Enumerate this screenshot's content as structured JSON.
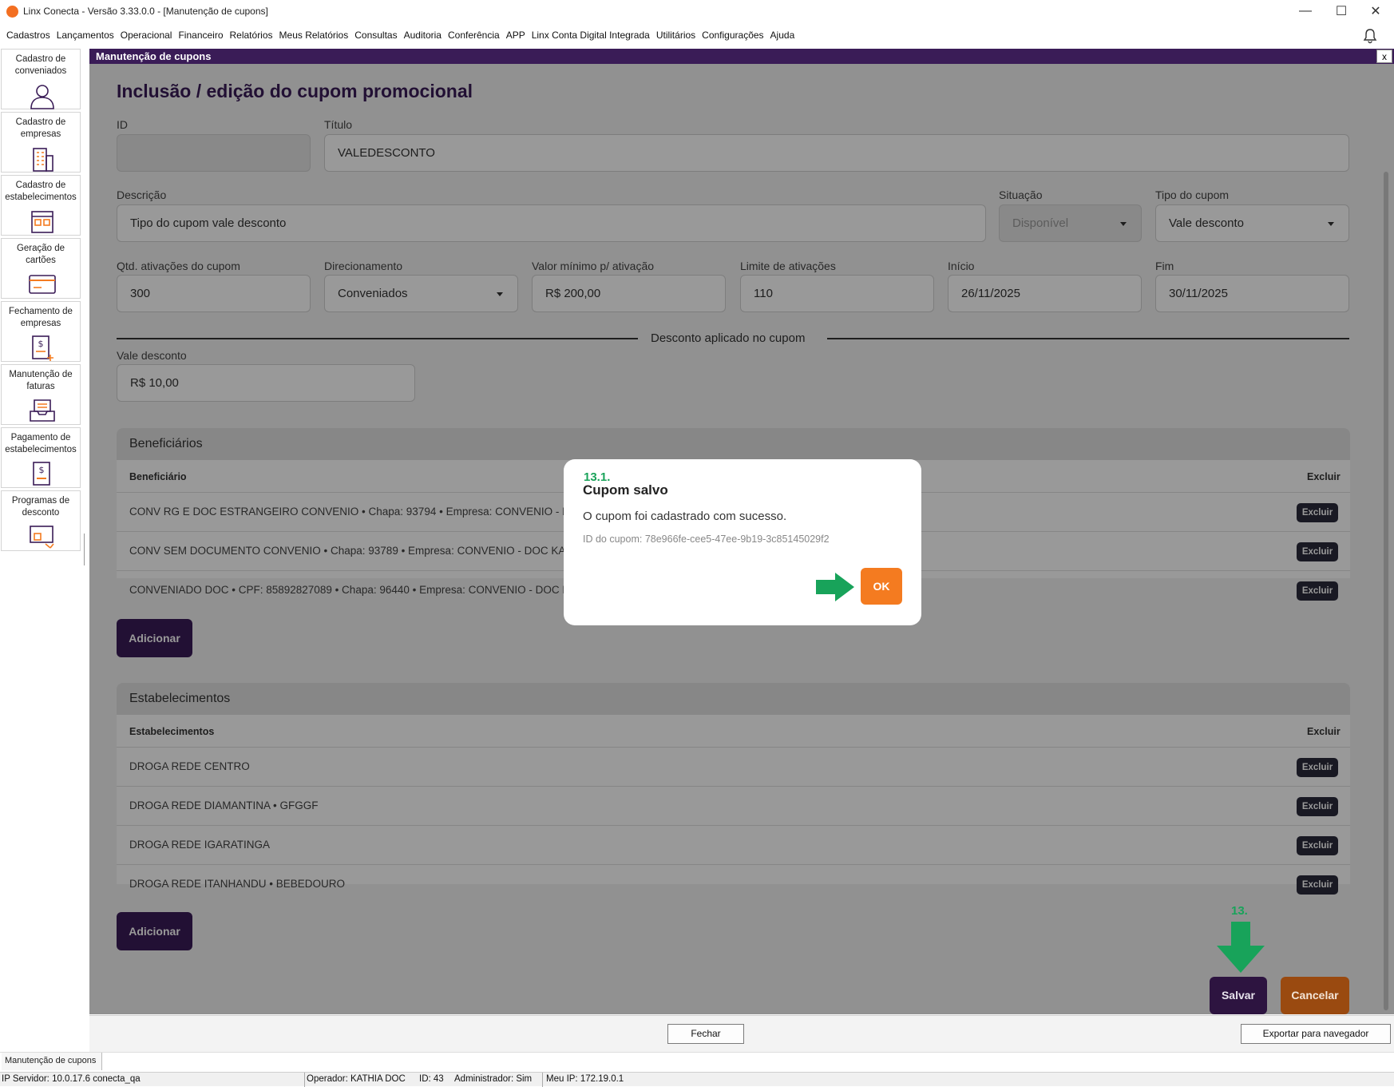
{
  "window": {
    "title": "Linx Conecta - Versão 3.33.0.0 - [Manutenção de cupons]",
    "minimize": "—",
    "maximize": "☐",
    "close": "✕"
  },
  "menu": [
    "Cadastros",
    "Lançamentos",
    "Operacional",
    "Financeiro",
    "Relatórios",
    "Meus Relatórios",
    "Consultas",
    "Auditoria",
    "Conferência",
    "APP",
    "Linx Conta Digital Integrada",
    "Utilitários",
    "Configurações",
    "Ajuda"
  ],
  "sidebar": {
    "items": [
      {
        "label": "Cadastro de conveniados",
        "icon": "user-icon"
      },
      {
        "label": "Cadastro de empresas",
        "icon": "building-icon"
      },
      {
        "label": "Cadastro de estabelecimentos",
        "icon": "store-icon"
      },
      {
        "label": "Geração de cartões",
        "icon": "card-icon"
      },
      {
        "label": "Fechamento de empresas",
        "icon": "invoice-icon"
      },
      {
        "label": "Manutenção de faturas",
        "icon": "tray-icon"
      },
      {
        "label": "Pagamento de estabelecimentos",
        "icon": "payment-icon"
      },
      {
        "label": "Programas de desconto",
        "icon": "discount-icon"
      }
    ]
  },
  "mdi": {
    "title": "Manutenção de cupons",
    "close": "x"
  },
  "form": {
    "heading": "Inclusão / edição do cupom promocional",
    "id_label": "ID",
    "id_value": "",
    "titulo_label": "Título",
    "titulo_value": "VALEDESCONTO",
    "descricao_label": "Descrição",
    "descricao_value": "Tipo do cupom vale desconto",
    "situacao_label": "Situação",
    "situacao_value": "Disponível",
    "tipo_label": "Tipo do cupom",
    "tipo_value": "Vale desconto",
    "qtd_label": "Qtd. ativações do cupom",
    "qtd_value": "300",
    "direcionamento_label": "Direcionamento",
    "direcionamento_value": "Conveniados",
    "valor_min_label": "Valor mínimo p/ ativação",
    "valor_min_value": "R$ 200,00",
    "limite_label": "Limite de ativações",
    "limite_value": "110",
    "inicio_label": "Início",
    "inicio_value": "26/11/2025",
    "fim_label": "Fim",
    "fim_value": "30/11/2025",
    "divider_label": "Desconto aplicado no cupom",
    "vale_label": "Vale desconto",
    "vale_value": "R$ 10,00"
  },
  "beneficiarios": {
    "title": "Beneficiários",
    "col_name": "Beneficiário",
    "col_delete": "Excluir",
    "rows": [
      "CONV RG E DOC ESTRANGEIRO CONVENIO • Chapa: 93794 • Empresa: CONVENIO - DO",
      "CONV SEM DOCUMENTO CONVENIO • Chapa: 93789 • Empresa: CONVENIO - DOC KAT",
      "CONVENIADO DOC • CPF: 85892827089 • Chapa: 96440 • Empresa: CONVENIO - DOC K"
    ],
    "delete_label": "Excluir",
    "add_label": "Adicionar"
  },
  "estabelecimentos": {
    "title": "Estabelecimentos",
    "col_name": "Estabelecimentos",
    "col_delete": "Excluir",
    "rows": [
      "DROGA REDE CENTRO",
      "DROGA REDE DIAMANTINA • GFGGF",
      "DROGA REDE IGARATINGA",
      "DROGA REDE ITANHANDU • BEBEDOURO"
    ],
    "delete_label": "Excluir",
    "add_label": "Adicionar"
  },
  "actions": {
    "save": "Salvar",
    "cancel": "Cancelar",
    "step": "13."
  },
  "modal": {
    "step": "13.1.",
    "title": "Cupom salvo",
    "message": "O cupom foi cadastrado com sucesso.",
    "id_text": "ID do cupom: 78e966fe-cee5-47ee-9b19-3c85145029f2",
    "ok": "OK"
  },
  "bottom": {
    "close": "Fechar",
    "export": "Exportar para navegador"
  },
  "taskbar": {
    "item": "Manutenção de cupons"
  },
  "status": {
    "server": "IP Servidor: 10.0.17.6 conecta_qa",
    "operator": "Operador: KATHIA DOC",
    "id": "ID: 43",
    "admin": "Administrador: Sim",
    "ip": "Meu IP: 172.19.0.1"
  },
  "colors": {
    "brand": "#3a1c57",
    "accent": "#f47b20",
    "guide": "#18a35a"
  }
}
